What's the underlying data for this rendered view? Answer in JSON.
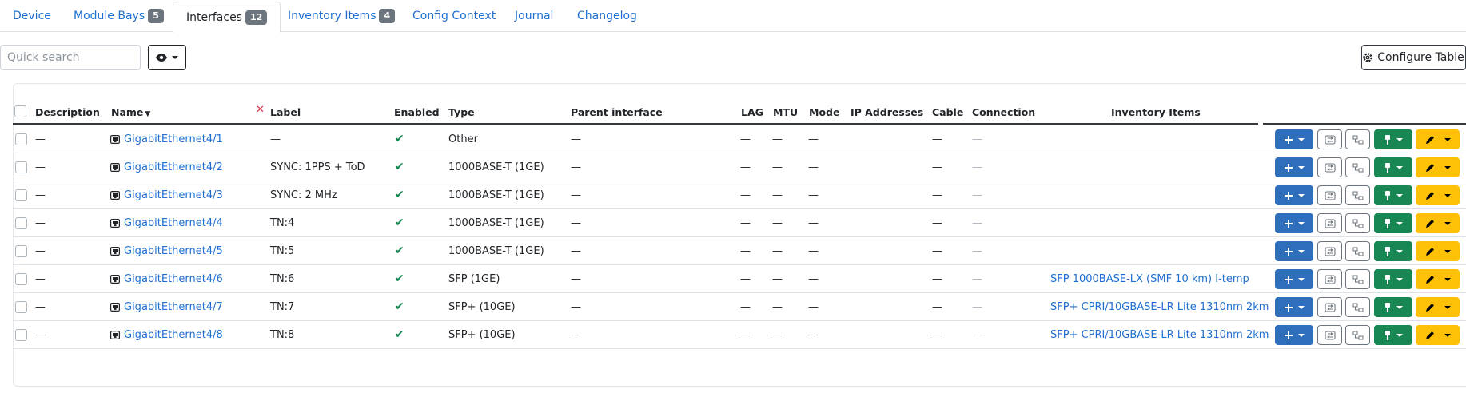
{
  "tabs": [
    {
      "label": "Device",
      "badge": null
    },
    {
      "label": "Module Bays",
      "badge": "5"
    },
    {
      "label": "Interfaces",
      "badge": "12",
      "active": true
    },
    {
      "label": "Inventory Items",
      "badge": "4"
    },
    {
      "label": "Config Context",
      "badge": null
    },
    {
      "label": "Journal",
      "badge": null
    },
    {
      "label": "Changelog",
      "badge": null
    }
  ],
  "toolbar": {
    "search_placeholder": "Quick search",
    "configure_label": "Configure Table"
  },
  "table": {
    "headers": {
      "description": "Description",
      "name": "Name",
      "label": "Label",
      "enabled": "Enabled",
      "type": "Type",
      "parent": "Parent interface",
      "lag": "LAG",
      "mtu": "MTU",
      "mode": "Mode",
      "ip": "IP Addresses",
      "cable": "Cable",
      "connection": "Connection",
      "inventory": "Inventory Items"
    },
    "rows": [
      {
        "description": "—",
        "name": "GigabitEthernet4/1",
        "label": "—",
        "enabled": "✔",
        "type": "Other",
        "parent": "—",
        "lag": "—",
        "mtu": "—",
        "mode": "—",
        "cable": "—",
        "connection": "—",
        "inventory": ""
      },
      {
        "description": "—",
        "name": "GigabitEthernet4/2",
        "label": "SYNC: 1PPS + ToD",
        "enabled": "✔",
        "type": "1000BASE-T (1GE)",
        "parent": "—",
        "lag": "—",
        "mtu": "—",
        "mode": "—",
        "cable": "—",
        "connection": "—",
        "inventory": ""
      },
      {
        "description": "—",
        "name": "GigabitEthernet4/3",
        "label": "SYNC: 2 MHz",
        "enabled": "✔",
        "type": "1000BASE-T (1GE)",
        "parent": "—",
        "lag": "—",
        "mtu": "—",
        "mode": "—",
        "cable": "—",
        "connection": "—",
        "inventory": ""
      },
      {
        "description": "—",
        "name": "GigabitEthernet4/4",
        "label": "TN:4",
        "enabled": "✔",
        "type": "1000BASE-T (1GE)",
        "parent": "—",
        "lag": "—",
        "mtu": "—",
        "mode": "—",
        "cable": "—",
        "connection": "—",
        "inventory": ""
      },
      {
        "description": "—",
        "name": "GigabitEthernet4/5",
        "label": "TN:5",
        "enabled": "✔",
        "type": "1000BASE-T (1GE)",
        "parent": "—",
        "lag": "—",
        "mtu": "—",
        "mode": "—",
        "cable": "—",
        "connection": "—",
        "inventory": ""
      },
      {
        "description": "—",
        "name": "GigabitEthernet4/6",
        "label": "TN:6",
        "enabled": "✔",
        "type": "SFP (1GE)",
        "parent": "—",
        "lag": "—",
        "mtu": "—",
        "mode": "—",
        "cable": "—",
        "connection": "—",
        "inventory": "SFP 1000BASE-LX (SMF 10 km) I-temp"
      },
      {
        "description": "—",
        "name": "GigabitEthernet4/7",
        "label": "TN:7",
        "enabled": "✔",
        "type": "SFP+ (10GE)",
        "parent": "—",
        "lag": "—",
        "mtu": "—",
        "mode": "—",
        "cable": "—",
        "connection": "—",
        "inventory": "SFP+ CPRI/10GBASE-LR Lite 1310nm 2km"
      },
      {
        "description": "—",
        "name": "GigabitEthernet4/8",
        "label": "TN:8",
        "enabled": "✔",
        "type": "SFP+ (10GE)",
        "parent": "—",
        "lag": "—",
        "mtu": "—",
        "mode": "—",
        "cable": "—",
        "connection": "—",
        "inventory": "SFP+ CPRI/10GBASE-LR Lite 1310nm 2km"
      }
    ]
  },
  "colors": {
    "link": "#1f6fd0",
    "primary": "#2f6eba",
    "success": "#198754",
    "warning": "#ffc107",
    "badge": "#6c757d"
  }
}
